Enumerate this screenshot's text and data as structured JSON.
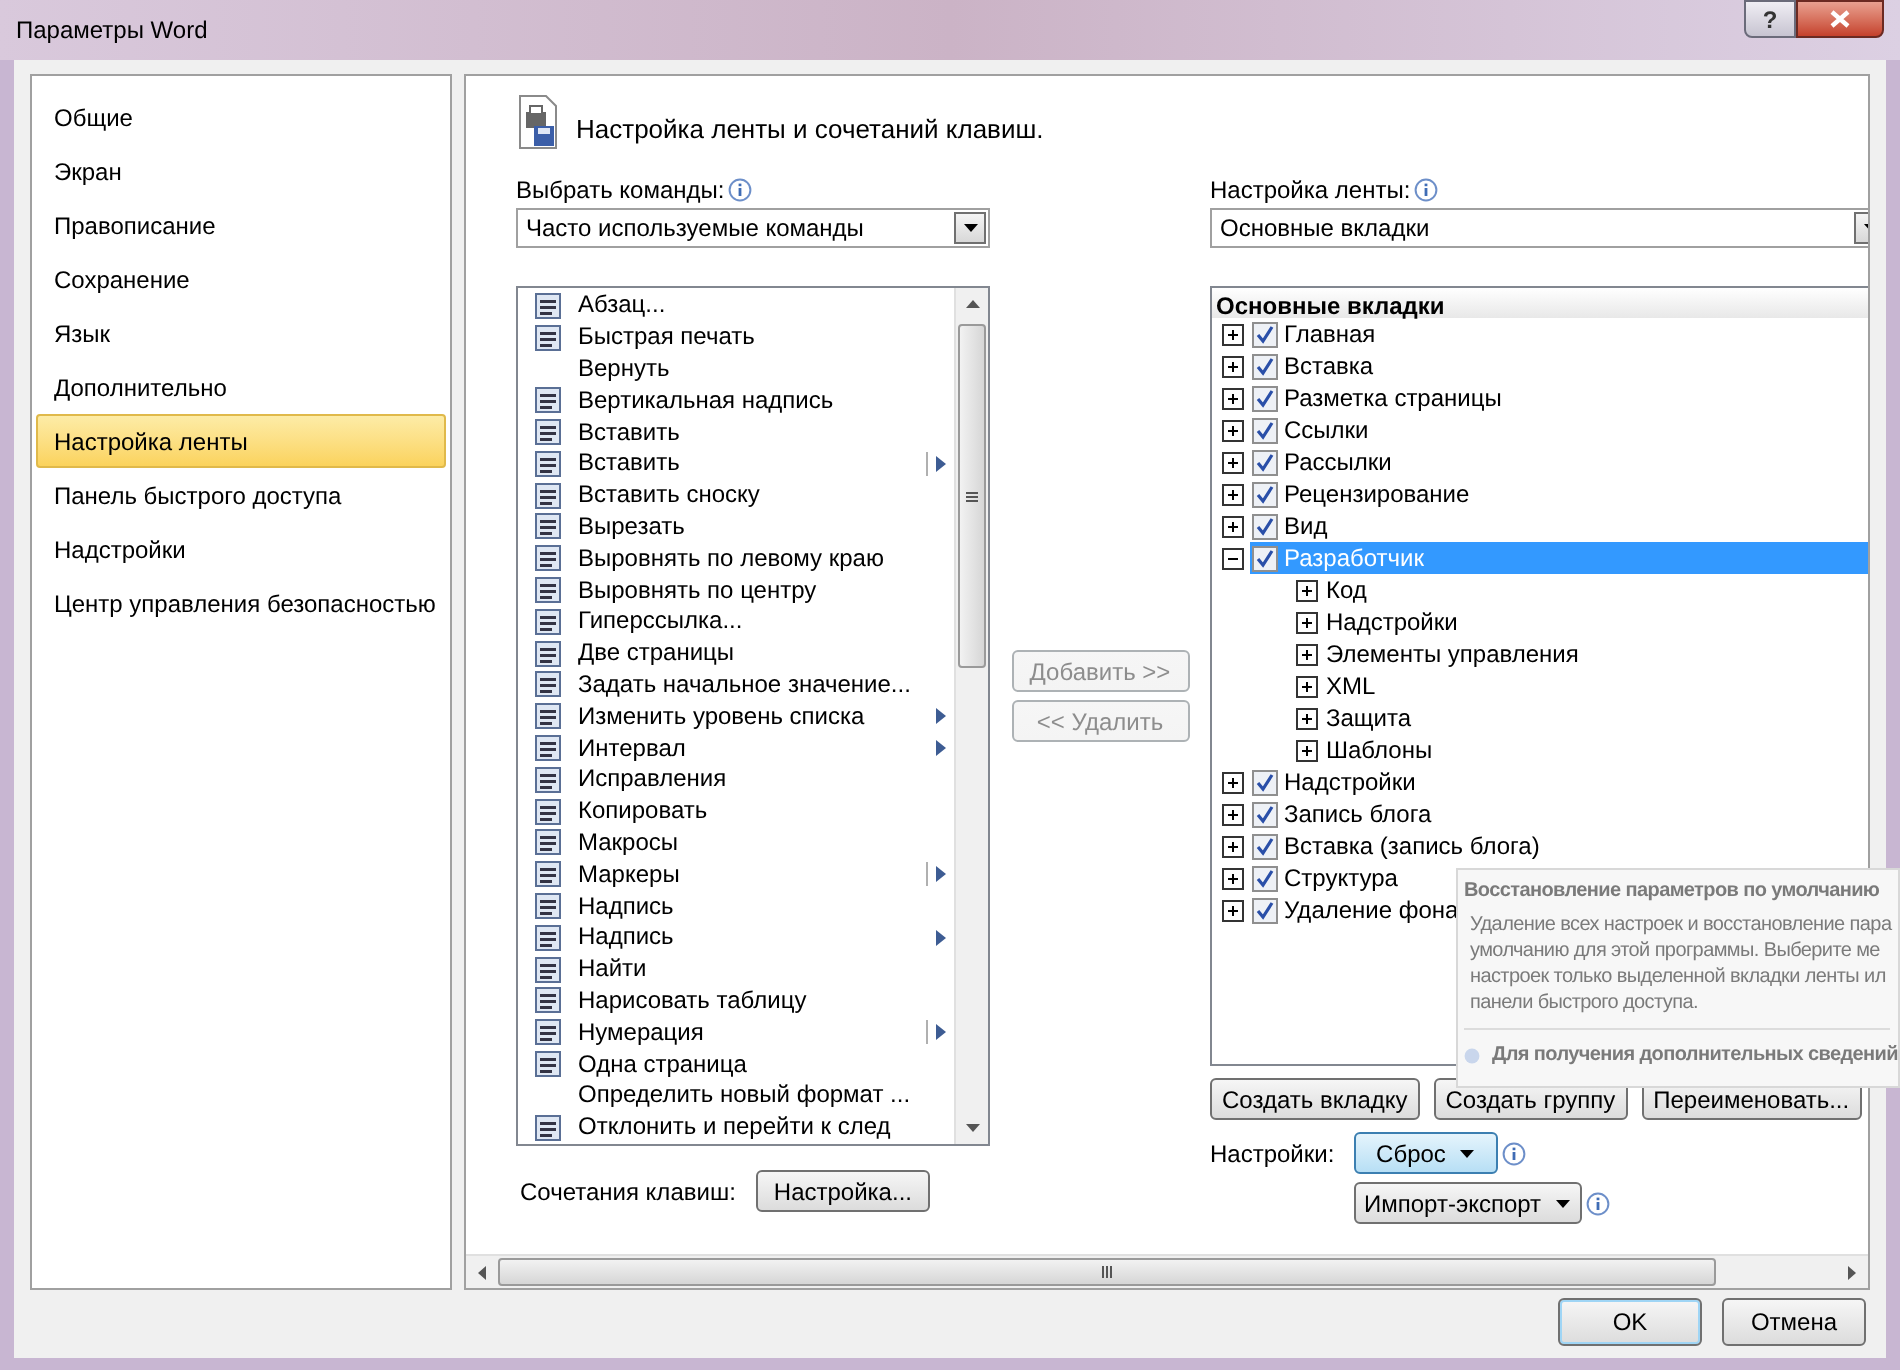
{
  "window": {
    "title": "Параметры Word",
    "help": "?"
  },
  "nav": [
    {
      "label": "Общие",
      "selected": false
    },
    {
      "label": "Экран",
      "selected": false
    },
    {
      "label": "Правописание",
      "selected": false
    },
    {
      "label": "Сохранение",
      "selected": false
    },
    {
      "label": "Язык",
      "selected": false
    },
    {
      "label": "Дополнительно",
      "selected": false
    },
    {
      "label": "Настройка ленты",
      "selected": true
    },
    {
      "label": "Панель быстрого доступа",
      "selected": false
    },
    {
      "label": "Надстройки",
      "selected": false
    },
    {
      "label": "Центр управления безопасностью",
      "selected": false
    }
  ],
  "heading": "Настройка ленты и сочетаний клавиш.",
  "commands": {
    "label": "Выбрать команды:",
    "value": "Часто используемые команды",
    "items": [
      {
        "label": "Абзац...",
        "icon": true
      },
      {
        "label": "Быстрая печать",
        "icon": true
      },
      {
        "label": "Вернуть",
        "icon": false
      },
      {
        "label": "Вертикальная надпись",
        "icon": true
      },
      {
        "label": "Вставить",
        "icon": true
      },
      {
        "label": "Вставить",
        "icon": true,
        "kind": "split"
      },
      {
        "label": "Вставить сноску",
        "icon": true
      },
      {
        "label": "Вырезать",
        "icon": true
      },
      {
        "label": "Выровнять по левому краю",
        "icon": true
      },
      {
        "label": "Выровнять по центру",
        "icon": true
      },
      {
        "label": "Гиперссылка...",
        "icon": true
      },
      {
        "label": "Две страницы",
        "icon": true
      },
      {
        "label": "Задать начальное значение...",
        "icon": true
      },
      {
        "label": "Изменить уровень списка",
        "icon": true,
        "kind": "submenu"
      },
      {
        "label": "Интервал",
        "icon": true,
        "kind": "submenu"
      },
      {
        "label": "Исправления",
        "icon": true
      },
      {
        "label": "Копировать",
        "icon": true
      },
      {
        "label": "Макросы",
        "icon": true
      },
      {
        "label": "Маркеры",
        "icon": true,
        "kind": "split"
      },
      {
        "label": "Надпись",
        "icon": true
      },
      {
        "label": "Надпись",
        "icon": true,
        "kind": "submenu"
      },
      {
        "label": "Найти",
        "icon": true
      },
      {
        "label": "Нарисовать таблицу",
        "icon": true
      },
      {
        "label": "Нумерация",
        "icon": true,
        "kind": "split"
      },
      {
        "label": "Одна страница",
        "icon": true
      },
      {
        "label": "Определить новый формат ...",
        "icon": false
      },
      {
        "label": "Отклонить и перейти к след",
        "icon": true
      }
    ]
  },
  "add_button": {
    "label": "Добавить >>",
    "disabled": true
  },
  "remove_button": {
    "label": "<< Удалить",
    "disabled": true
  },
  "shortcuts": {
    "label": "Сочетания клавиш:",
    "button": "Настройка..."
  },
  "ribbon": {
    "label": "Настройка ленты:",
    "value": "Основные вкладки",
    "tree_header": "Основные вкладки",
    "tabs": [
      {
        "label": "Главная",
        "checked": true,
        "expanded": false,
        "selected": false
      },
      {
        "label": "Вставка",
        "checked": true,
        "expanded": false,
        "selected": false
      },
      {
        "label": "Разметка страницы",
        "checked": true,
        "expanded": false,
        "selected": false
      },
      {
        "label": "Ссылки",
        "checked": true,
        "expanded": false,
        "selected": false
      },
      {
        "label": "Рассылки",
        "checked": true,
        "expanded": false,
        "selected": false
      },
      {
        "label": "Рецензирование",
        "checked": true,
        "expanded": false,
        "selected": false
      },
      {
        "label": "Вид",
        "checked": true,
        "expanded": false,
        "selected": false
      },
      {
        "label": "Разработчик",
        "checked": true,
        "expanded": true,
        "selected": true,
        "children": [
          {
            "label": "Код",
            "expanded": false
          },
          {
            "label": "Надстройки",
            "expanded": false
          },
          {
            "label": "Элементы управления",
            "expanded": false
          },
          {
            "label": "XML",
            "expanded": false
          },
          {
            "label": "Защита",
            "expanded": false
          },
          {
            "label": "Шаблоны",
            "expanded": false
          }
        ]
      },
      {
        "label": "Надстройки",
        "checked": true,
        "expanded": false,
        "selected": false
      },
      {
        "label": "Запись блога",
        "checked": true,
        "expanded": false,
        "selected": false
      },
      {
        "label": "Вставка (запись блога)",
        "checked": true,
        "expanded": false,
        "selected": false
      },
      {
        "label": "Структура",
        "checked": true,
        "expanded": false,
        "selected": false
      },
      {
        "label": "Удаление фона",
        "checked": true,
        "expanded": false,
        "selected": false
      }
    ],
    "buttons": [
      "Создать вкладку",
      "Создать группу",
      "Переименовать..."
    ],
    "settings_label": "Настройки:",
    "reset": "Сброс",
    "import_export": "Импорт-экспорт"
  },
  "tooltip": {
    "title": "Восстановление параметров по умолчанию",
    "lines": [
      "Удаление всех настроек и восстановление пара",
      "умолчанию для этой программы. Выберите ме",
      "настроек только выделенной вкладки ленты ил",
      "панели быстрого доступа."
    ],
    "help": "Для получения дополнительных сведений"
  },
  "footer": {
    "ok": "OK",
    "cancel": "Отмена"
  }
}
